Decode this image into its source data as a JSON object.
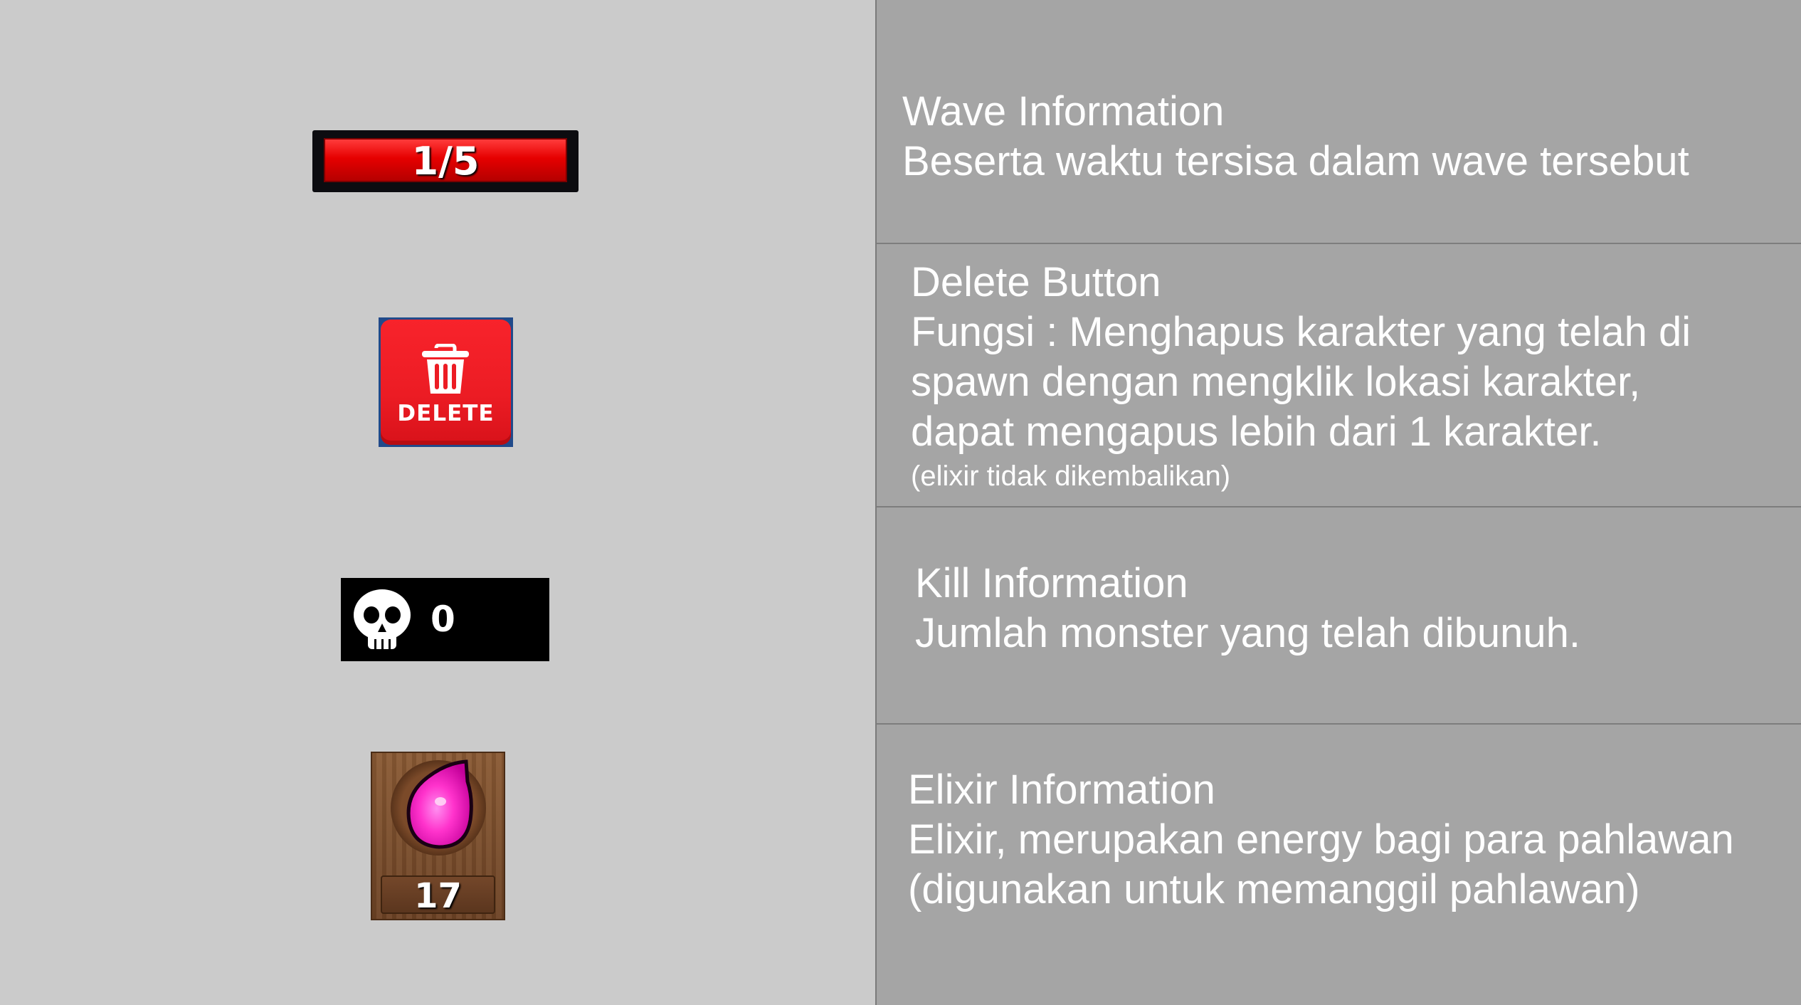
{
  "wave": {
    "label": "1/5",
    "current": 1,
    "total": 5,
    "info_title": "Wave Information",
    "info_desc": "Beserta waktu tersisa dalam wave tersebut"
  },
  "delete": {
    "label": "DELETE",
    "icon": "trash-icon",
    "info_title": "Delete Button",
    "info_line1": "Fungsi : Menghapus karakter yang telah di",
    "info_line2": "spawn dengan mengklik lokasi karakter,",
    "info_line3": "dapat mengapus lebih dari 1 karakter.",
    "info_note": "(elixir tidak dikembalikan)"
  },
  "kill": {
    "count": "0",
    "icon": "skull-icon",
    "info_title": "Kill Information",
    "info_desc": "Jumlah monster yang telah dibunuh."
  },
  "elixir": {
    "count": "17",
    "icon": "elixir-drop-icon",
    "info_title": "Elixir Information",
    "info_line1": "Elixir, merupakan energy bagi para pahlawan",
    "info_line2": "(digunakan untuk memanggil pahlawan)"
  },
  "colors": {
    "left_bg": "#cbcbcb",
    "right_bg": "#a5a5a5",
    "wave_red": "#e60000",
    "delete_red": "#ec1c24",
    "elixir_pink": "#ff33cc"
  }
}
